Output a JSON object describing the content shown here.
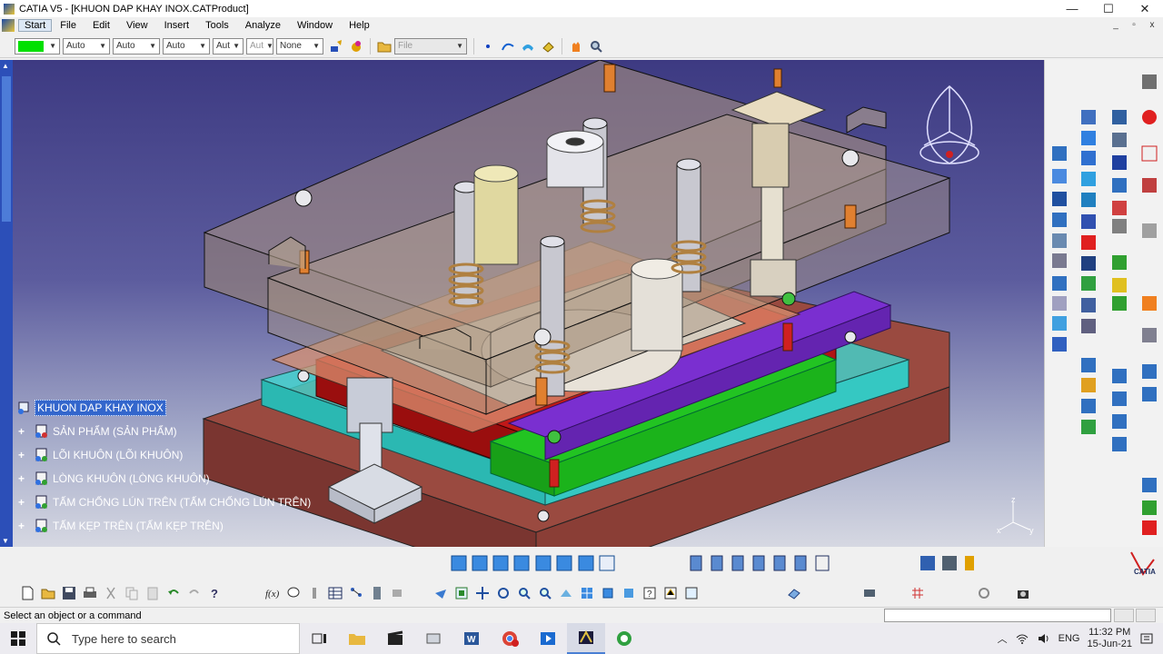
{
  "window": {
    "title": "CATIA V5 - [KHUON DAP KHAY INOX.CATProduct]",
    "minimize": "—",
    "maximize": "☐",
    "close": "✕",
    "mdi_min": "_",
    "mdi_restore": "▫",
    "mdi_close": "x"
  },
  "menu": {
    "items": [
      "Start",
      "File",
      "Edit",
      "View",
      "Insert",
      "Tools",
      "Analyze",
      "Window",
      "Help"
    ]
  },
  "toolbar": {
    "color_value": "#00e000",
    "combos": [
      "Auto",
      "Auto",
      "Auto",
      "Aut",
      "Aut",
      "None"
    ],
    "file_combo": "File"
  },
  "tree": {
    "root": "KHUON DAP KHAY INOX",
    "children": [
      "SẢN PHẨM (SẢN PHẨM)",
      "LÕI KHUÔN (LÕI KHUÔN)",
      "LÒNG KHUÔN (LÒNG KHUÔN)",
      "TẤM CHỐNG LÚN TRÊN (TẤM CHỐNG LÚN TRÊN)",
      "TẤM KẸP TRÊN (TẤM KẸP TRÊN)"
    ]
  },
  "axis": {
    "z": "z",
    "x": "x",
    "y": "y"
  },
  "status": {
    "message": "Select an object or a command"
  },
  "taskbar": {
    "search_placeholder": "Type here to search",
    "lang": "ENG",
    "time": "11:32 PM",
    "date": "15-Jun-21"
  },
  "colors": {
    "background_top": "#3d3a82",
    "background_bottom": "#d6d8e2",
    "tree_highlight": "#3366cc",
    "plate_cyan": "#3fd6d0",
    "plate_red": "#c01818",
    "plate_green": "#22c422",
    "plate_purple": "#7a2fd0",
    "plate_brown": "#a04a40"
  }
}
